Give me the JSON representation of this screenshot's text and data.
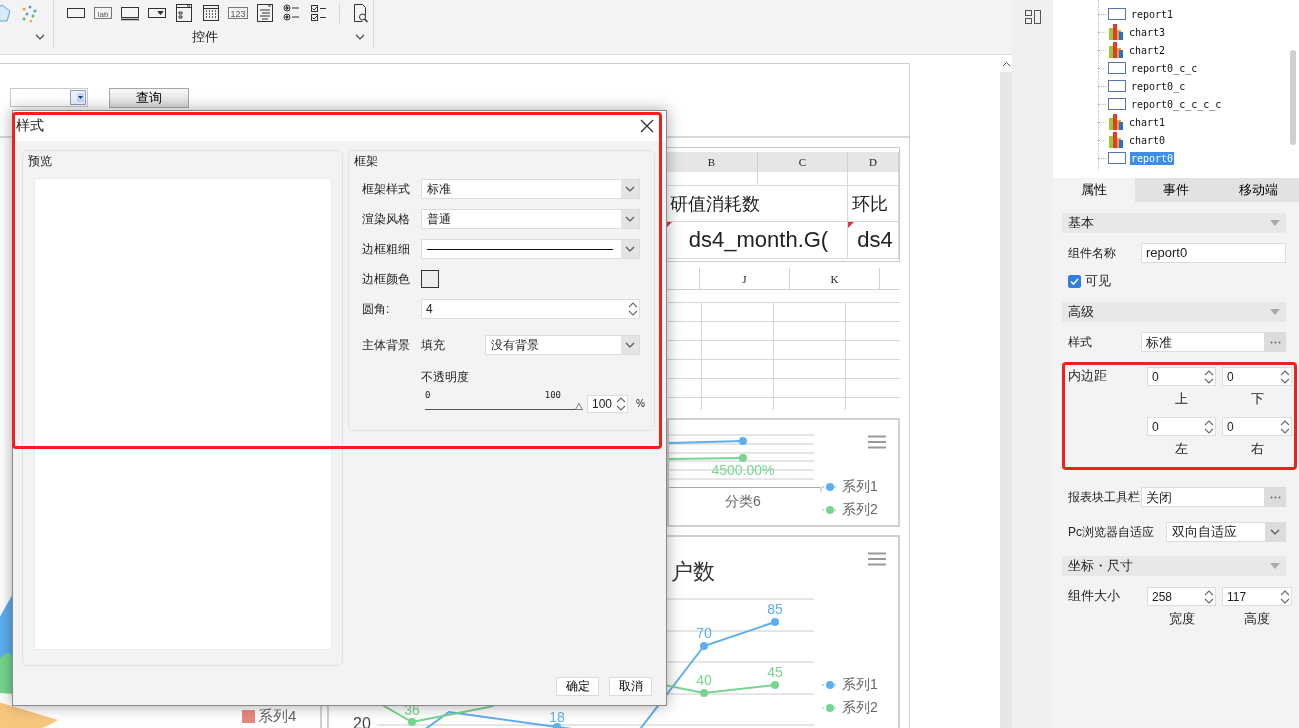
{
  "toolbar": {
    "chart_icons": [
      {
        "kind": "radar"
      },
      {
        "kind": "scatter"
      }
    ],
    "control_group": {
      "label": "控件",
      "icons": [
        {
          "kind": "textbox"
        },
        {
          "kind": "label",
          "text": "lab"
        },
        {
          "kind": "button"
        },
        {
          "kind": "dropdown"
        },
        {
          "kind": "list"
        },
        {
          "kind": "calendar"
        },
        {
          "kind": "number",
          "text": "123"
        },
        {
          "kind": "textarea"
        },
        {
          "kind": "radio"
        },
        {
          "kind": "checkbox"
        }
      ]
    },
    "tool_icons": [
      {
        "kind": "preview"
      }
    ]
  },
  "query_bar": {
    "button": "查询"
  },
  "report_block": {
    "columns": [
      "B",
      "C",
      "D"
    ],
    "rows": [
      [
        {
          "text": "研值消耗数",
          "marked": false
        },
        {
          "text": "环比",
          "marked": false
        }
      ],
      [
        {
          "text": "ds4_month.G(",
          "marked": true
        },
        {
          "text": "ds4",
          "marked": true
        }
      ]
    ]
  },
  "sheet_grid": {
    "columns": [
      "J",
      "K"
    ]
  },
  "line_chart_top": {
    "point_label": "4500.00%",
    "category": "分类6",
    "legend": [
      {
        "name": "系列1",
        "color": "#5eaef0"
      },
      {
        "name": "系列2",
        "color": "#76d68f"
      }
    ]
  },
  "line_chart_bottom": {
    "title": "户数",
    "axis_label": "20",
    "point_labels": [
      {
        "text": "36",
        "color": "#76d68f"
      },
      {
        "text": "18",
        "color": "#5eaef0"
      },
      {
        "text": "70",
        "color": "#5eaef0"
      },
      {
        "text": "85",
        "color": "#5eaef0"
      },
      {
        "text": "40",
        "color": "#76d68f"
      },
      {
        "text": "45",
        "color": "#76d68f"
      }
    ],
    "legend": [
      {
        "name": "系列1",
        "color": "#5eaef0"
      },
      {
        "name": "系列2",
        "color": "#76d68f"
      }
    ]
  },
  "pie_chart": {
    "legend": [
      {
        "name": "系列4",
        "color": "#e8897f"
      }
    ]
  },
  "dialog": {
    "title": "样式",
    "highlighted": true,
    "preview": {
      "label": "预览"
    },
    "frame": {
      "label": "框架",
      "fields": [
        {
          "kind": "select",
          "label": "框架样式",
          "value": "标准"
        },
        {
          "kind": "select",
          "label": "渲染风格",
          "value": "普通"
        },
        {
          "kind": "line-select",
          "label": "边框粗细"
        },
        {
          "kind": "color",
          "label": "边框颜色",
          "color": "#eeeeee"
        },
        {
          "kind": "spinner",
          "label": "圆角:",
          "value": "4"
        }
      ],
      "background": {
        "label": "主体背景",
        "fill_label": "填充",
        "value": "没有背景"
      },
      "opacity": {
        "label": "不透明度",
        "min": "0",
        "max": "100",
        "level": 1,
        "value": "100",
        "unit": "%"
      }
    },
    "buttons": [
      "确定",
      "取消"
    ]
  },
  "tree": {
    "items": [
      {
        "label": "report1",
        "kind": "report",
        "selected": false
      },
      {
        "label": "chart3",
        "kind": "chart",
        "selected": false
      },
      {
        "label": "chart2",
        "kind": "chart",
        "selected": false
      },
      {
        "label": "report0_c_c",
        "kind": "report",
        "selected": false
      },
      {
        "label": "report0_c",
        "kind": "report",
        "selected": false
      },
      {
        "label": "report0_c_c_c_c",
        "kind": "report",
        "selected": false
      },
      {
        "label": "chart1",
        "kind": "chart",
        "selected": false
      },
      {
        "label": "chart0",
        "kind": "chart",
        "selected": false
      },
      {
        "label": "report0",
        "kind": "report",
        "selected": true
      }
    ]
  },
  "tabs": [
    {
      "label": "属性",
      "selected": true
    },
    {
      "label": "事件",
      "selected": false
    },
    {
      "label": "移动端",
      "selected": false
    }
  ],
  "properties": {
    "sections": [
      {
        "title": "基本",
        "rows": [
          {
            "kind": "text",
            "label": "组件名称",
            "value": "report0"
          },
          {
            "kind": "checkbox",
            "label": "可见",
            "checked": true
          }
        ]
      },
      {
        "title": "高级",
        "rows": [
          {
            "kind": "picker",
            "label": "样式",
            "value": "标准"
          },
          {
            "kind": "padding",
            "label": "内边距",
            "highlighted": true,
            "fields": [
              {
                "value": "0",
                "caption": "上"
              },
              {
                "value": "0",
                "caption": "下"
              },
              {
                "value": "0",
                "caption": "左"
              },
              {
                "value": "0",
                "caption": "右"
              }
            ]
          },
          {
            "kind": "picker",
            "label": "报表块工具栏",
            "value": "关闭"
          },
          {
            "kind": "select",
            "label": "Pc浏览器自适应",
            "value": "双向自适应"
          }
        ]
      },
      {
        "title": "坐标・尺寸",
        "rows": [
          {
            "kind": "size",
            "label": "组件大小",
            "fields": [
              {
                "value": "258",
                "caption": "宽度"
              },
              {
                "value": "117",
                "caption": "高度"
              }
            ]
          }
        ]
      }
    ]
  }
}
